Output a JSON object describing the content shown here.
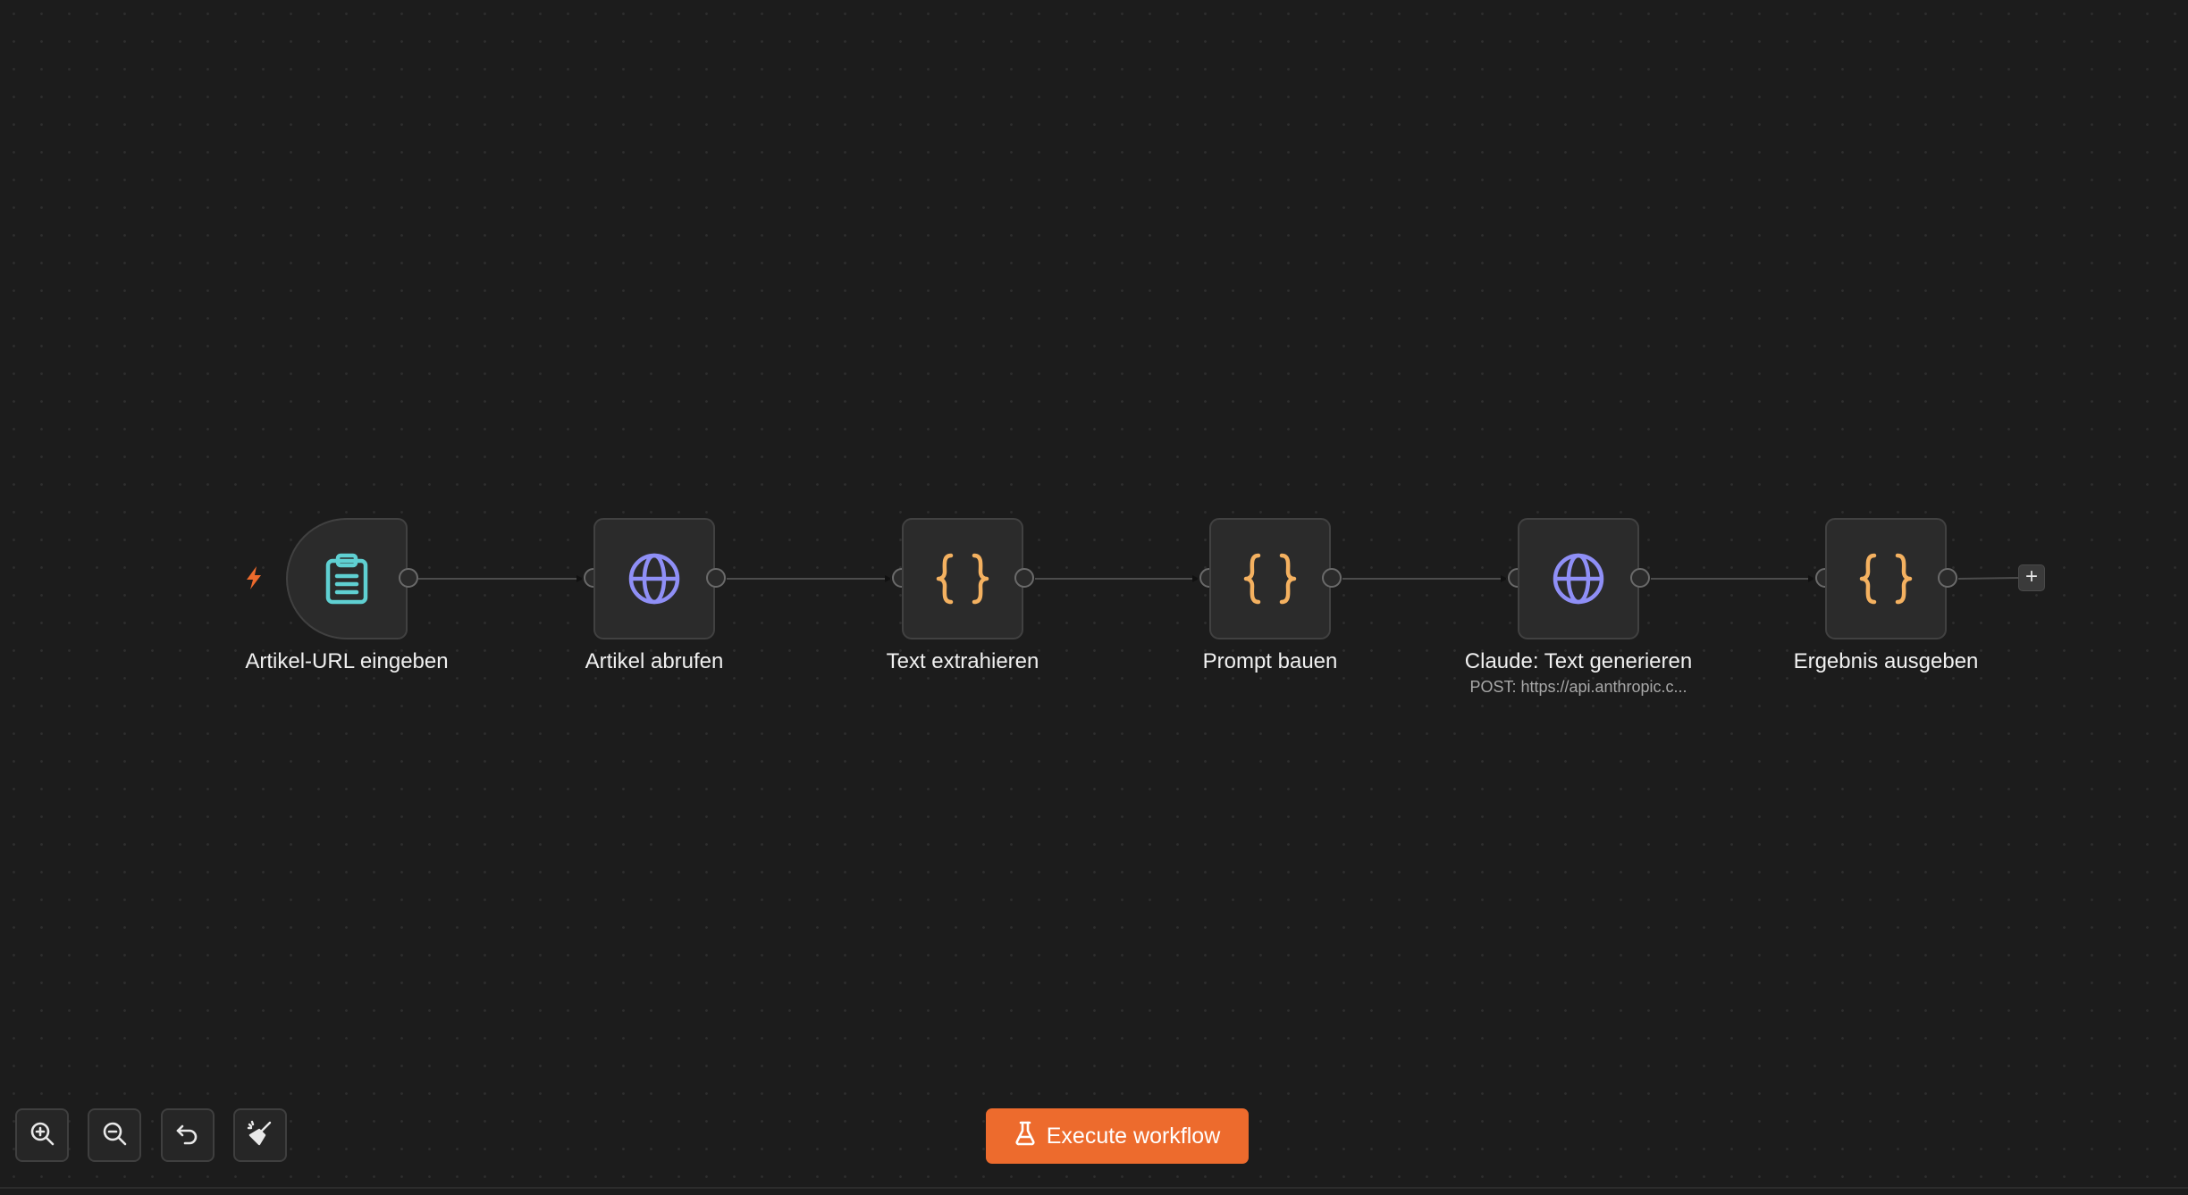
{
  "canvas": {
    "nodes": [
      {
        "id": "trigger",
        "label": "Artikel-URL eingeben",
        "icon": "clipboard-icon",
        "icon_color": "#5fd0d2",
        "sublabel": ""
      },
      {
        "id": "fetch",
        "label": "Artikel abrufen",
        "icon": "globe-icon",
        "icon_color": "#8f8ff6",
        "sublabel": ""
      },
      {
        "id": "extract",
        "label": "Text extrahieren",
        "icon": "braces-icon",
        "icon_color": "#f4b160",
        "sublabel": ""
      },
      {
        "id": "prompt",
        "label": "Prompt bauen",
        "icon": "braces-icon",
        "icon_color": "#f4b160",
        "sublabel": ""
      },
      {
        "id": "claude",
        "label": "Claude: Text generieren",
        "icon": "globe-icon",
        "icon_color": "#8f8ff6",
        "sublabel": "POST: https://api.anthropic.c..."
      },
      {
        "id": "output",
        "label": "Ergebnis ausgeben",
        "icon": "braces-icon",
        "icon_color": "#f4b160",
        "sublabel": ""
      }
    ],
    "trigger_icon": "lightning-bolt-icon",
    "trigger_color": "#ec6a2c",
    "add_node_label": "+"
  },
  "controls": {
    "zoom_in": "zoom-in-icon",
    "zoom_out": "zoom-out-icon",
    "reset": "undo-icon",
    "tidy": "broom-icon"
  },
  "toolbar": {
    "execute_label": "Execute workflow",
    "execute_icon": "flask-icon",
    "accent": "#ed6b2d"
  }
}
